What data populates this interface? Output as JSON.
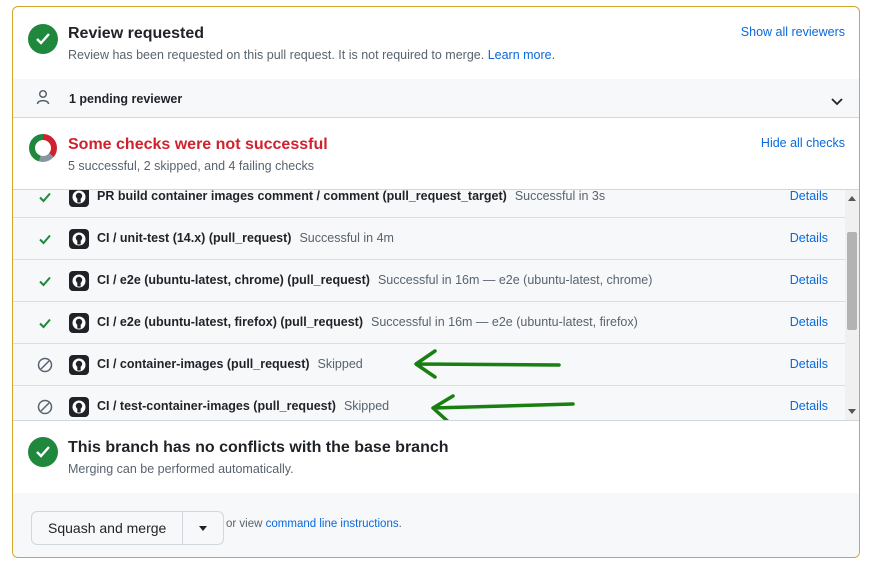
{
  "review": {
    "title": "Review requested",
    "subtitle": "Review has been requested on this pull request. It is not required to merge.",
    "learn_more": "Learn more.",
    "show_all": "Show all reviewers"
  },
  "pending": {
    "label": "1 pending reviewer"
  },
  "checks": {
    "title": "Some checks were not successful",
    "subtitle": "5 successful, 2 skipped, and 4 failing checks",
    "hide_all": "Hide all checks",
    "colors": {
      "fail": "#cf222e",
      "success": "#1f883d",
      "skipped": "#8c959f"
    }
  },
  "check_list": [
    {
      "state": "success",
      "name": "PR build container images comment / comment (pull_request_target)",
      "desc": "Successful in 3s",
      "details": "Details"
    },
    {
      "state": "success",
      "name": "CI / unit-test (14.x) (pull_request)",
      "desc": "Successful in 4m",
      "details": "Details"
    },
    {
      "state": "success",
      "name": "CI / e2e (ubuntu-latest, chrome) (pull_request)",
      "desc": "Successful in 16m — e2e (ubuntu-latest, chrome)",
      "details": "Details"
    },
    {
      "state": "success",
      "name": "CI / e2e (ubuntu-latest, firefox) (pull_request)",
      "desc": "Successful in 16m — e2e (ubuntu-latest, firefox)",
      "details": "Details"
    },
    {
      "state": "skipped",
      "name": "CI / container-images (pull_request)",
      "desc": "Skipped",
      "details": "Details"
    },
    {
      "state": "skipped",
      "name": "CI / test-container-images (pull_request)",
      "desc": "Skipped",
      "details": "Details"
    }
  ],
  "branch": {
    "title": "This branch has no conflicts with the base branch",
    "subtitle": "Merging can be performed automatically."
  },
  "merge": {
    "button": "Squash and merge",
    "or_view": "or view",
    "instructions": "command line instructions",
    "period": "."
  },
  "annotation_color": "#1a7f12"
}
